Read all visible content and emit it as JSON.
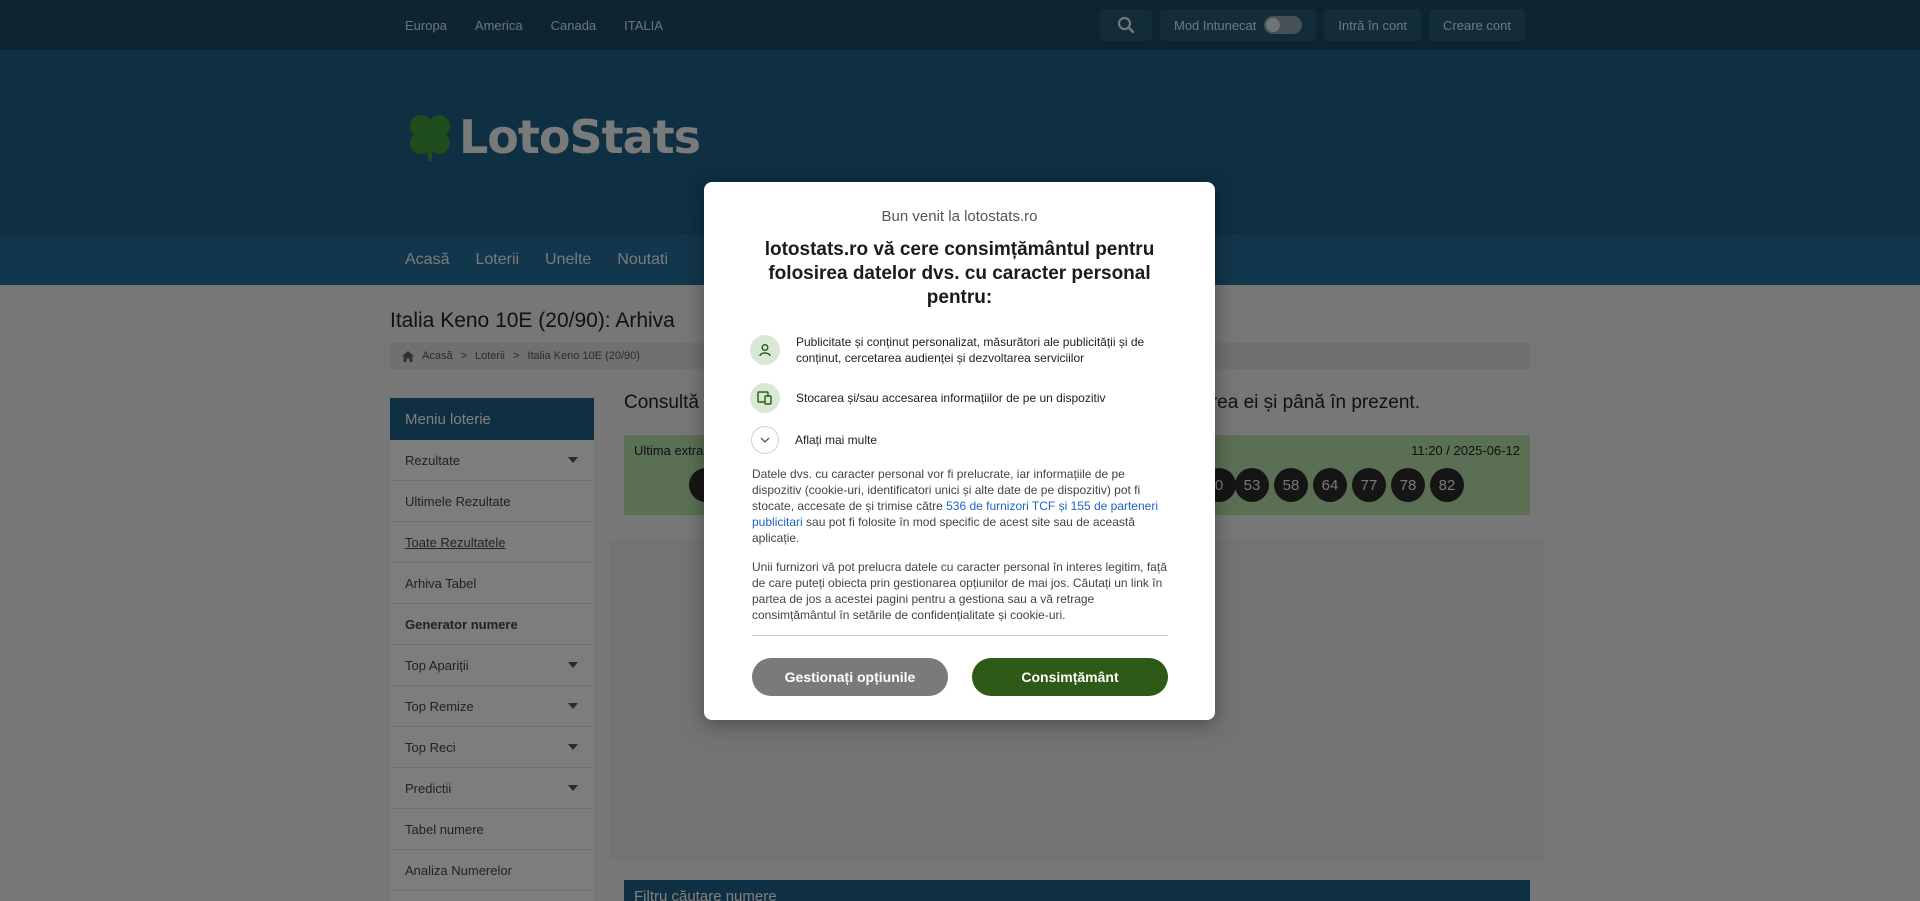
{
  "topbar": {
    "regions": [
      "Europa",
      "America",
      "Canada",
      "ITALIA"
    ],
    "dark_mode_label": "Mod Intunecat",
    "login_label": "Intră în cont",
    "register_label": "Creare cont"
  },
  "header": {
    "logo_text": "LotoStats"
  },
  "main_nav": [
    "Acasă",
    "Loterii",
    "Unelte",
    "Noutati"
  ],
  "page": {
    "title": "Italia Keno 10E (20/90): Arhiva",
    "breadcrumb": [
      "Acasă",
      "Loterii",
      "Italia Keno 10E (20/90)"
    ],
    "intro_left": "Consultă",
    "intro_right": "țarea ei și până în prezent."
  },
  "sidebar": {
    "title": "Meniu loterie",
    "items": [
      {
        "label": "Rezultate",
        "caret": true,
        "bold": false,
        "underline": false
      },
      {
        "label": "Ultimele Rezultate",
        "caret": false,
        "bold": false,
        "underline": false
      },
      {
        "label": "Toate Rezultatele",
        "caret": false,
        "bold": false,
        "underline": true
      },
      {
        "label": "Arhiva Tabel",
        "caret": false,
        "bold": false,
        "underline": false
      },
      {
        "label": "Generator numere",
        "caret": false,
        "bold": true,
        "underline": false
      },
      {
        "label": "Top Apariții",
        "caret": true,
        "bold": false,
        "underline": false
      },
      {
        "label": "Top Remize",
        "caret": true,
        "bold": false,
        "underline": false
      },
      {
        "label": "Top Reci",
        "caret": true,
        "bold": false,
        "underline": false
      },
      {
        "label": "Predictii",
        "caret": true,
        "bold": false,
        "underline": false
      },
      {
        "label": "Tabel numere",
        "caret": false,
        "bold": false,
        "underline": false
      },
      {
        "label": "Analiza Numerelor",
        "caret": false,
        "bold": false,
        "underline": false
      }
    ]
  },
  "last_draw": {
    "label": "Ultima extra",
    "datetime": "11:20 / 2025-06-12",
    "partial_ball": "0",
    "visible_numbers": [
      "53",
      "58",
      "64",
      "77",
      "78",
      "82"
    ]
  },
  "filter_title": "Filtru căutare numere",
  "consent": {
    "welcome": "Bun venit la lotostats.ro",
    "title": "lotostats.ro vă cere consimțământul pentru folosirea datelor dvs. cu caracter personal pentru:",
    "purposes": [
      {
        "icon": "person-icon",
        "text": "Publicitate și conținut personalizat, măsurători ale publicității și de conținut, cercetarea audienței și dezvoltarea serviciilor"
      },
      {
        "icon": "device-icon",
        "text": "Stocarea și/sau accesarea informațiilor de pe un dispozitiv"
      }
    ],
    "learn_more": "Aflați mai multe",
    "para1_before": "Datele dvs. cu caracter personal vor fi prelucrate, iar informațiile de pe dispozitiv (cookie-uri, identificatori unici și alte date de pe dispozitiv) pot fi stocate, accesate de și trimise către",
    "para1_link": "536 de furnizori TCF și 155 de parteneri publicitari",
    "para1_after": "sau pot fi folosite în mod specific de acest site sau de această aplicație.",
    "para2": "Unii furnizori vă pot prelucra datele cu caracter personal în interes legitim, față de care puteți obiecta prin gestionarea opțiunilor de mai jos. Căutați un link în partea de jos a acestei pagini pentru a gestiona sau a vă retrage consimțământul în setările de confidențialitate și cookie-uri.",
    "manage_label": "Gestionați opțiunile",
    "consent_label": "Consimțământ"
  }
}
